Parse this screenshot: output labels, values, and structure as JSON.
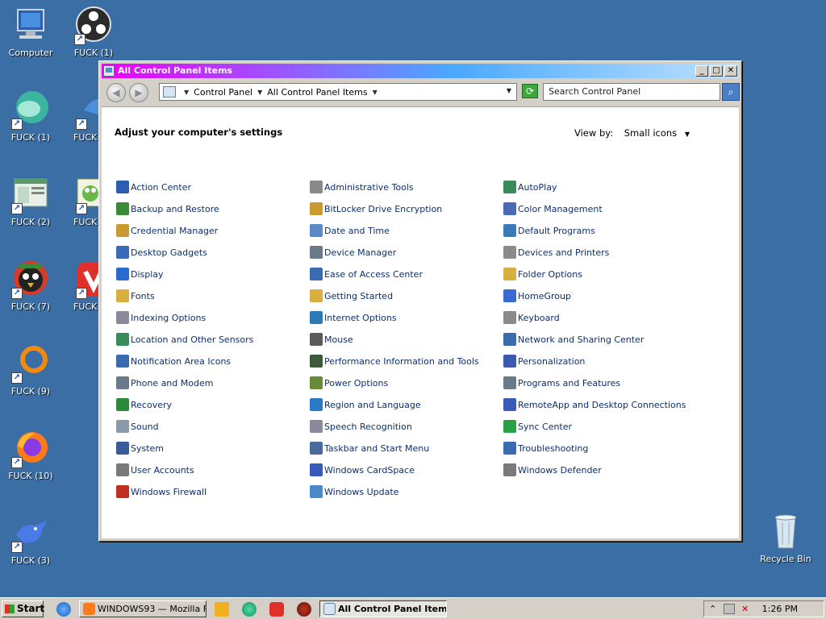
{
  "desktop": {
    "icons": [
      {
        "label": "Computer",
        "name": "computer-icon"
      },
      {
        "label": "FUCK (1)",
        "name": "obs-icon"
      },
      {
        "label": "FUCK (1)",
        "name": "teal-bird-icon"
      },
      {
        "label": "FUCK",
        "name": "shortcut-icon"
      },
      {
        "label": "FUCK (2)",
        "name": "window-app-icon"
      },
      {
        "label": "FUCK",
        "name": "frog-app-icon"
      },
      {
        "label": "FUCK (7)",
        "name": "angry-bird-icon"
      },
      {
        "label": "FUCK",
        "name": "vivaldi-icon"
      },
      {
        "label": "FUCK (9)",
        "name": "orange-ring-icon"
      },
      {
        "label": "FUCK (10)",
        "name": "firefox-icon"
      },
      {
        "label": "FUCK (3)",
        "name": "blue-bird-icon"
      },
      {
        "label": "Recycle Bin",
        "name": "recycle-bin-icon"
      }
    ]
  },
  "window": {
    "title": "All Control Panel Items",
    "buttons": {
      "minimize": "_",
      "maximize": "□",
      "close": "✕"
    },
    "nav": {
      "back": "◀",
      "forward": "▶"
    },
    "address": {
      "crumb1": "Control Panel",
      "crumb2": "All Control Panel Items"
    },
    "search_placeholder": "Search Control Panel",
    "heading": "Adjust your computer's settings",
    "view_by_label": "View by:",
    "view_by_value": "Small icons",
    "items": [
      [
        "Action Center",
        "Backup and Restore",
        "Credential Manager",
        "Desktop Gadgets",
        "Display",
        "Fonts",
        "Indexing Options",
        "Location and Other Sensors",
        "Notification Area Icons",
        "Phone and Modem",
        "Recovery",
        "Sound",
        "System",
        "User Accounts",
        "Windows Firewall"
      ],
      [
        "Administrative Tools",
        "BitLocker Drive Encryption",
        "Date and Time",
        "Device Manager",
        "Ease of Access Center",
        "Getting Started",
        "Internet Options",
        "Mouse",
        "Performance Information and Tools",
        "Power Options",
        "Region and Language",
        "Speech Recognition",
        "Taskbar and Start Menu",
        "Windows CardSpace",
        "Windows Update"
      ],
      [
        "AutoPlay",
        "Color Management",
        "Default Programs",
        "Devices and Printers",
        "Folder Options",
        "HomeGroup",
        "Keyboard",
        "Network and Sharing Center",
        "Personalization",
        "Programs and Features",
        "RemoteApp and Desktop Connections",
        "Sync Center",
        "Troubleshooting",
        "Windows Defender"
      ]
    ]
  },
  "taskbar": {
    "start": "Start",
    "tasks": [
      {
        "label": "WINDOWS93 — Mozilla F...",
        "active": false
      },
      {
        "label": "All Control Panel Items",
        "active": true
      }
    ],
    "clock": "1:26 PM"
  },
  "colors": {
    "desktop": "#3a6ea5",
    "title_gradient_start": "#ee00ff",
    "title_gradient_end": "#bfe3ff",
    "link": "#0c2f70"
  }
}
